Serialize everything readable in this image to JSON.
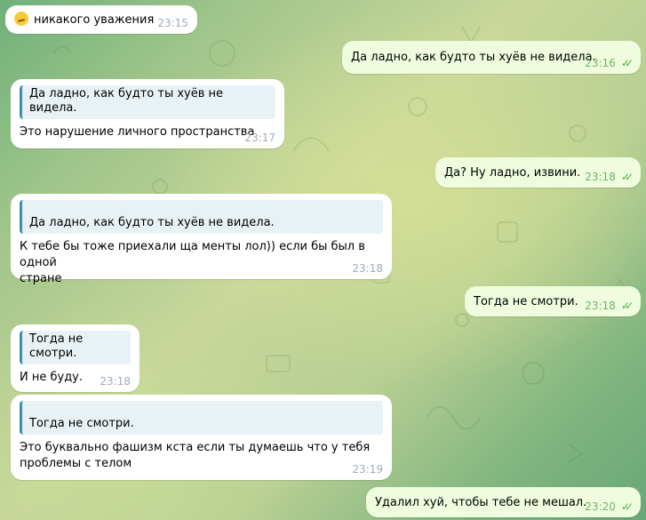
{
  "messages": [
    {
      "dir": "in",
      "emoji": "smirk-emoji",
      "text": "никакого уважения",
      "time": "23:15"
    },
    {
      "dir": "out",
      "text": "Да ладно, как будто ты хуёв не видела.",
      "time": "23:16"
    },
    {
      "dir": "in",
      "quote": "Да ладно, как будто ты хуёв не видела.",
      "text": "Это нарушение личного пространства",
      "time": "23:17"
    },
    {
      "dir": "out",
      "text": "Да? Ну ладно, извини.",
      "time": "23:18"
    },
    {
      "dir": "in",
      "quote": "Да ладно, как будто ты хуёв не видела.",
      "text": "К тебе бы тоже приехали ща менты лол)) если бы был в одной\nстране",
      "time": "23:18"
    },
    {
      "dir": "out",
      "text": "Тогда не смотри.",
      "time": "23:18"
    },
    {
      "dir": "in",
      "quote": "Тогда не смотри.",
      "text": "И не буду.",
      "time": "23:18"
    },
    {
      "dir": "in",
      "quote": "Тогда не смотри.",
      "text": "Это буквально фашизм кста если ты думаешь что у тебя\nпроблемы с телом",
      "time": "23:19"
    },
    {
      "dir": "out",
      "text": "Удалил хуй, чтобы тебе не мешал.",
      "time": "23:20"
    }
  ],
  "colors": {
    "incoming": "#ffffff",
    "outgoing": "#effdde",
    "quote_bar": "#3a8fb7",
    "read_check": "#4fae4e"
  }
}
